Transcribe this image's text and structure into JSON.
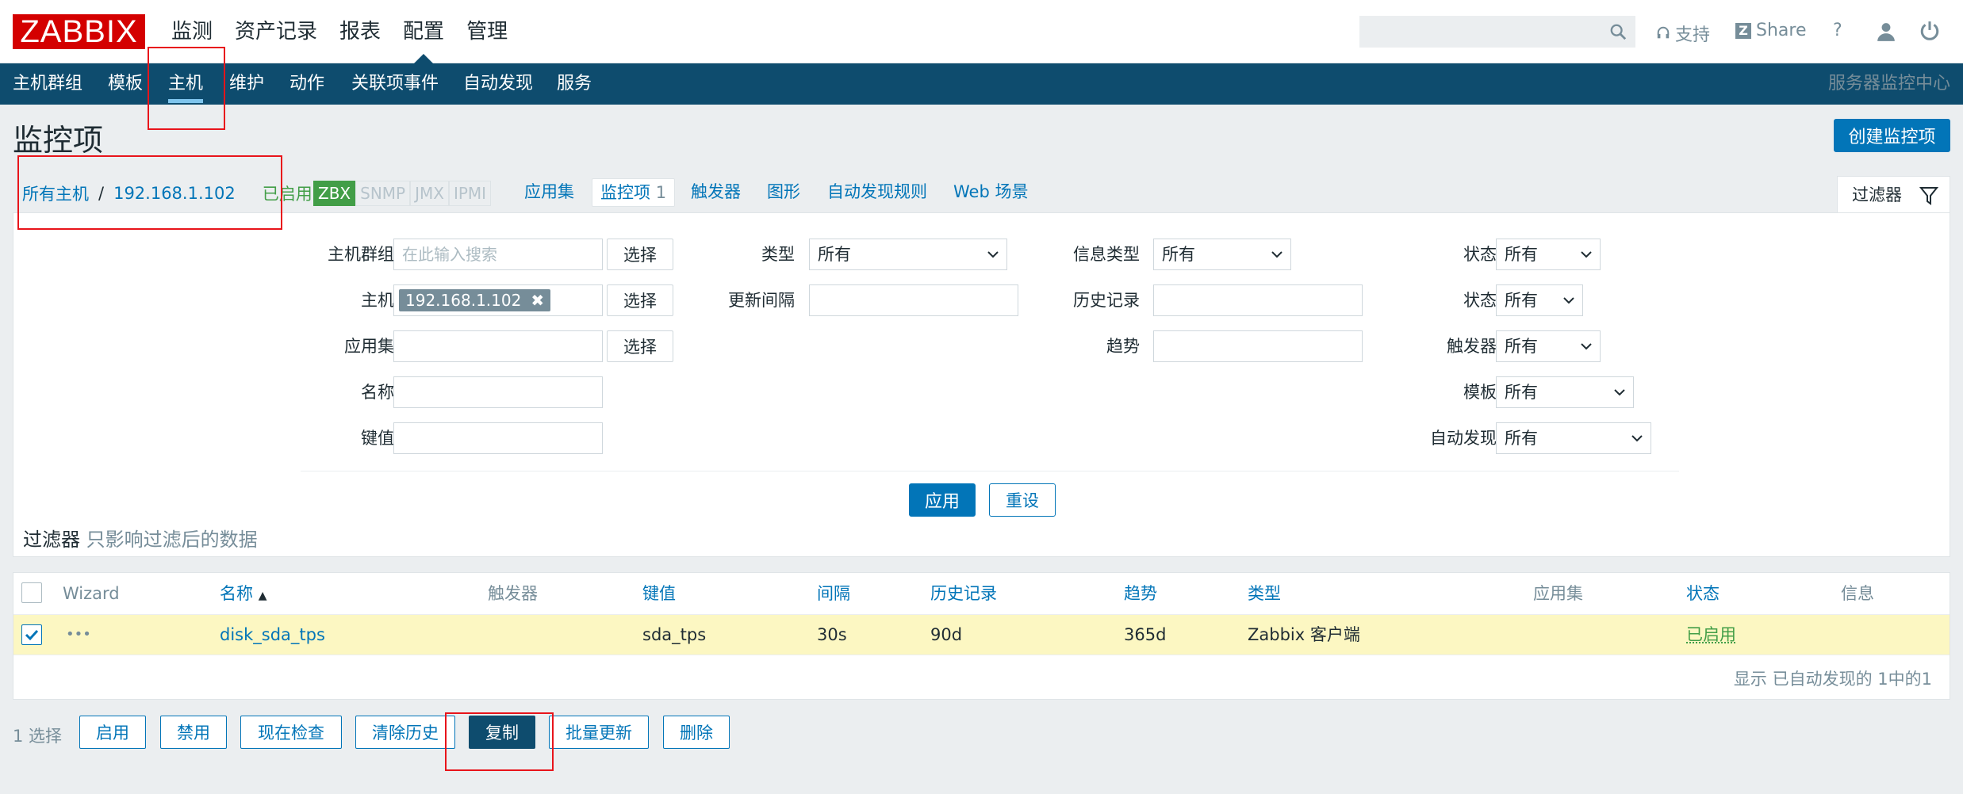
{
  "brand": {
    "logo_text": "ZABBIX",
    "logo_color": "#d40000"
  },
  "top_menu": [
    "监测",
    "资产记录",
    "报表",
    "配置",
    "管理"
  ],
  "top_menu_selected": "配置",
  "search": {
    "value": "",
    "placeholder": ""
  },
  "top_links": {
    "support": "支持",
    "share": "Share",
    "help": "?"
  },
  "sub_nav": {
    "items": [
      "主机群组",
      "模板",
      "主机",
      "维护",
      "动作",
      "关联项事件",
      "自动发现",
      "服务"
    ],
    "selected": "主机",
    "right_text": "服务器监控中心"
  },
  "page": {
    "title": "监控项",
    "create_button": "创建监控项"
  },
  "breadcrumb": {
    "all_hosts": "所有主机",
    "separator": "/",
    "host": "192.168.1.102",
    "status": "已启用"
  },
  "availability": [
    "ZBX",
    "SNMP",
    "JMX",
    "IPMI"
  ],
  "tabs": {
    "applications": "应用集",
    "items": "监控项",
    "items_count": "1",
    "triggers": "触发器",
    "graphs": "图形",
    "discovery": "自动发现规则",
    "web": "Web 场景"
  },
  "filter_tab": "过滤器",
  "filter": {
    "host_group": {
      "label": "主机群组",
      "placeholder": "在此输入搜索",
      "button": "选择"
    },
    "host": {
      "label": "主机",
      "chip": "192.168.1.102",
      "button": "选择"
    },
    "application": {
      "label": "应用集",
      "value": "",
      "button": "选择"
    },
    "name": {
      "label": "名称",
      "value": ""
    },
    "key": {
      "label": "键值",
      "value": ""
    },
    "type": {
      "label": "类型",
      "value": "所有"
    },
    "update_interval": {
      "label": "更新间隔",
      "value": ""
    },
    "info_type": {
      "label": "信息类型",
      "value": "所有"
    },
    "history": {
      "label": "历史记录",
      "value": ""
    },
    "trends": {
      "label": "趋势",
      "value": ""
    },
    "state": {
      "label": "状态",
      "value": "所有"
    },
    "status": {
      "label": "状态",
      "value": "所有"
    },
    "triggers": {
      "label": "触发器",
      "value": "所有"
    },
    "template": {
      "label": "模板",
      "value": "所有"
    },
    "discovered": {
      "label": "自动发现",
      "value": "所有"
    },
    "apply_button": "应用",
    "reset_button": "重设",
    "note_title": "过滤器",
    "note_sub": "只影响过滤后的数据"
  },
  "table": {
    "headers": {
      "wizard": "Wizard",
      "name": "名称",
      "triggers": "触发器",
      "key": "键值",
      "interval": "间隔",
      "history": "历史记录",
      "trends": "趋势",
      "type": "类型",
      "applications": "应用集",
      "status": "状态",
      "info": "信息"
    },
    "rows": [
      {
        "wizard": "•••",
        "name": "disk_sda_tps",
        "triggers": "",
        "key": "sda_tps",
        "interval": "30s",
        "history": "90d",
        "trends": "365d",
        "type": "Zabbix 客户端",
        "applications": "",
        "status": "已启用",
        "info": ""
      }
    ],
    "footer": "显示 已自动发现的 1中的1"
  },
  "actions": {
    "selected_count": "1 选择",
    "enable": "启用",
    "disable": "禁用",
    "check_now": "现在检查",
    "clear_history": "清除历史",
    "copy": "复制",
    "mass_update": "批量更新",
    "delete": "删除"
  },
  "colors": {
    "header_nav": "#0e4c6e",
    "accent": "#0275b8",
    "enabled_green": "#429e47",
    "selected_row": "#fcf7c2",
    "annotation_red": "#e8141b"
  }
}
